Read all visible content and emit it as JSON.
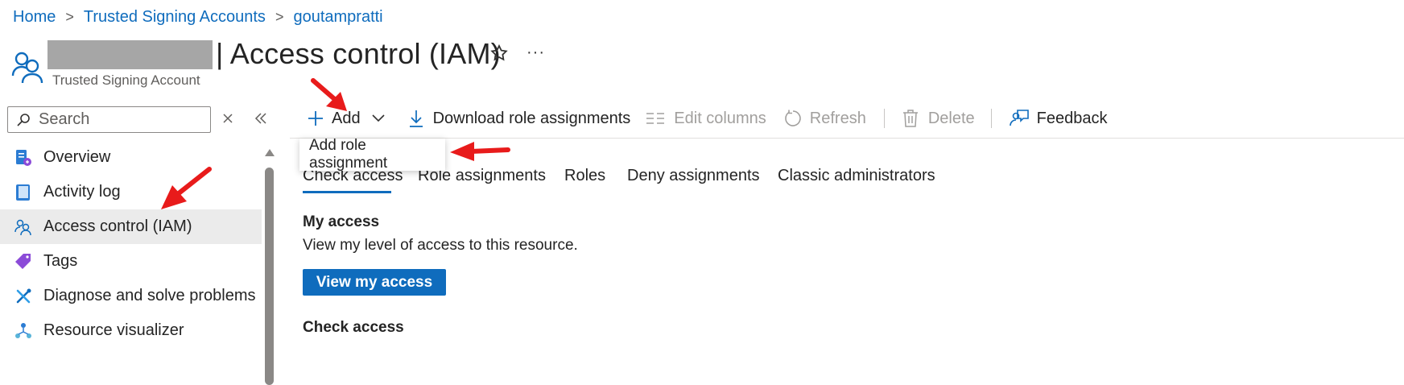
{
  "breadcrumb": {
    "items": [
      "Home",
      "Trusted Signing Accounts",
      "goutampratti"
    ],
    "separator": ">"
  },
  "header": {
    "title": "| Access control (IAM)",
    "subtitle": "Trusted Signing Account",
    "more_label": "···"
  },
  "sidebar": {
    "search_placeholder": "Search",
    "items": [
      {
        "label": "Overview",
        "icon": "overview-icon"
      },
      {
        "label": "Activity log",
        "icon": "activity-log-icon"
      },
      {
        "label": "Access control (IAM)",
        "icon": "people-icon",
        "active": true
      },
      {
        "label": "Tags",
        "icon": "tag-icon"
      },
      {
        "label": "Diagnose and solve problems",
        "icon": "wrench-icon"
      },
      {
        "label": "Resource visualizer",
        "icon": "visualizer-icon"
      }
    ]
  },
  "toolbar": {
    "add_label": "Add",
    "download_label": "Download role assignments",
    "edit_columns_label": "Edit columns",
    "refresh_label": "Refresh",
    "delete_label": "Delete",
    "feedback_label": "Feedback"
  },
  "add_menu": {
    "items": [
      "Add role assignment"
    ]
  },
  "tabs": [
    "Check access",
    "Role assignments",
    "Roles",
    "Deny assignments",
    "Classic administrators"
  ],
  "content": {
    "my_access_heading": "My access",
    "my_access_text": "View my level of access to this resource.",
    "view_my_access_button": "View my access",
    "check_access_heading": "Check access"
  },
  "colors": {
    "accent": "#0f6cbd",
    "annotation_arrow": "#e81b1b",
    "active_nav_bg": "#ebebeb"
  }
}
